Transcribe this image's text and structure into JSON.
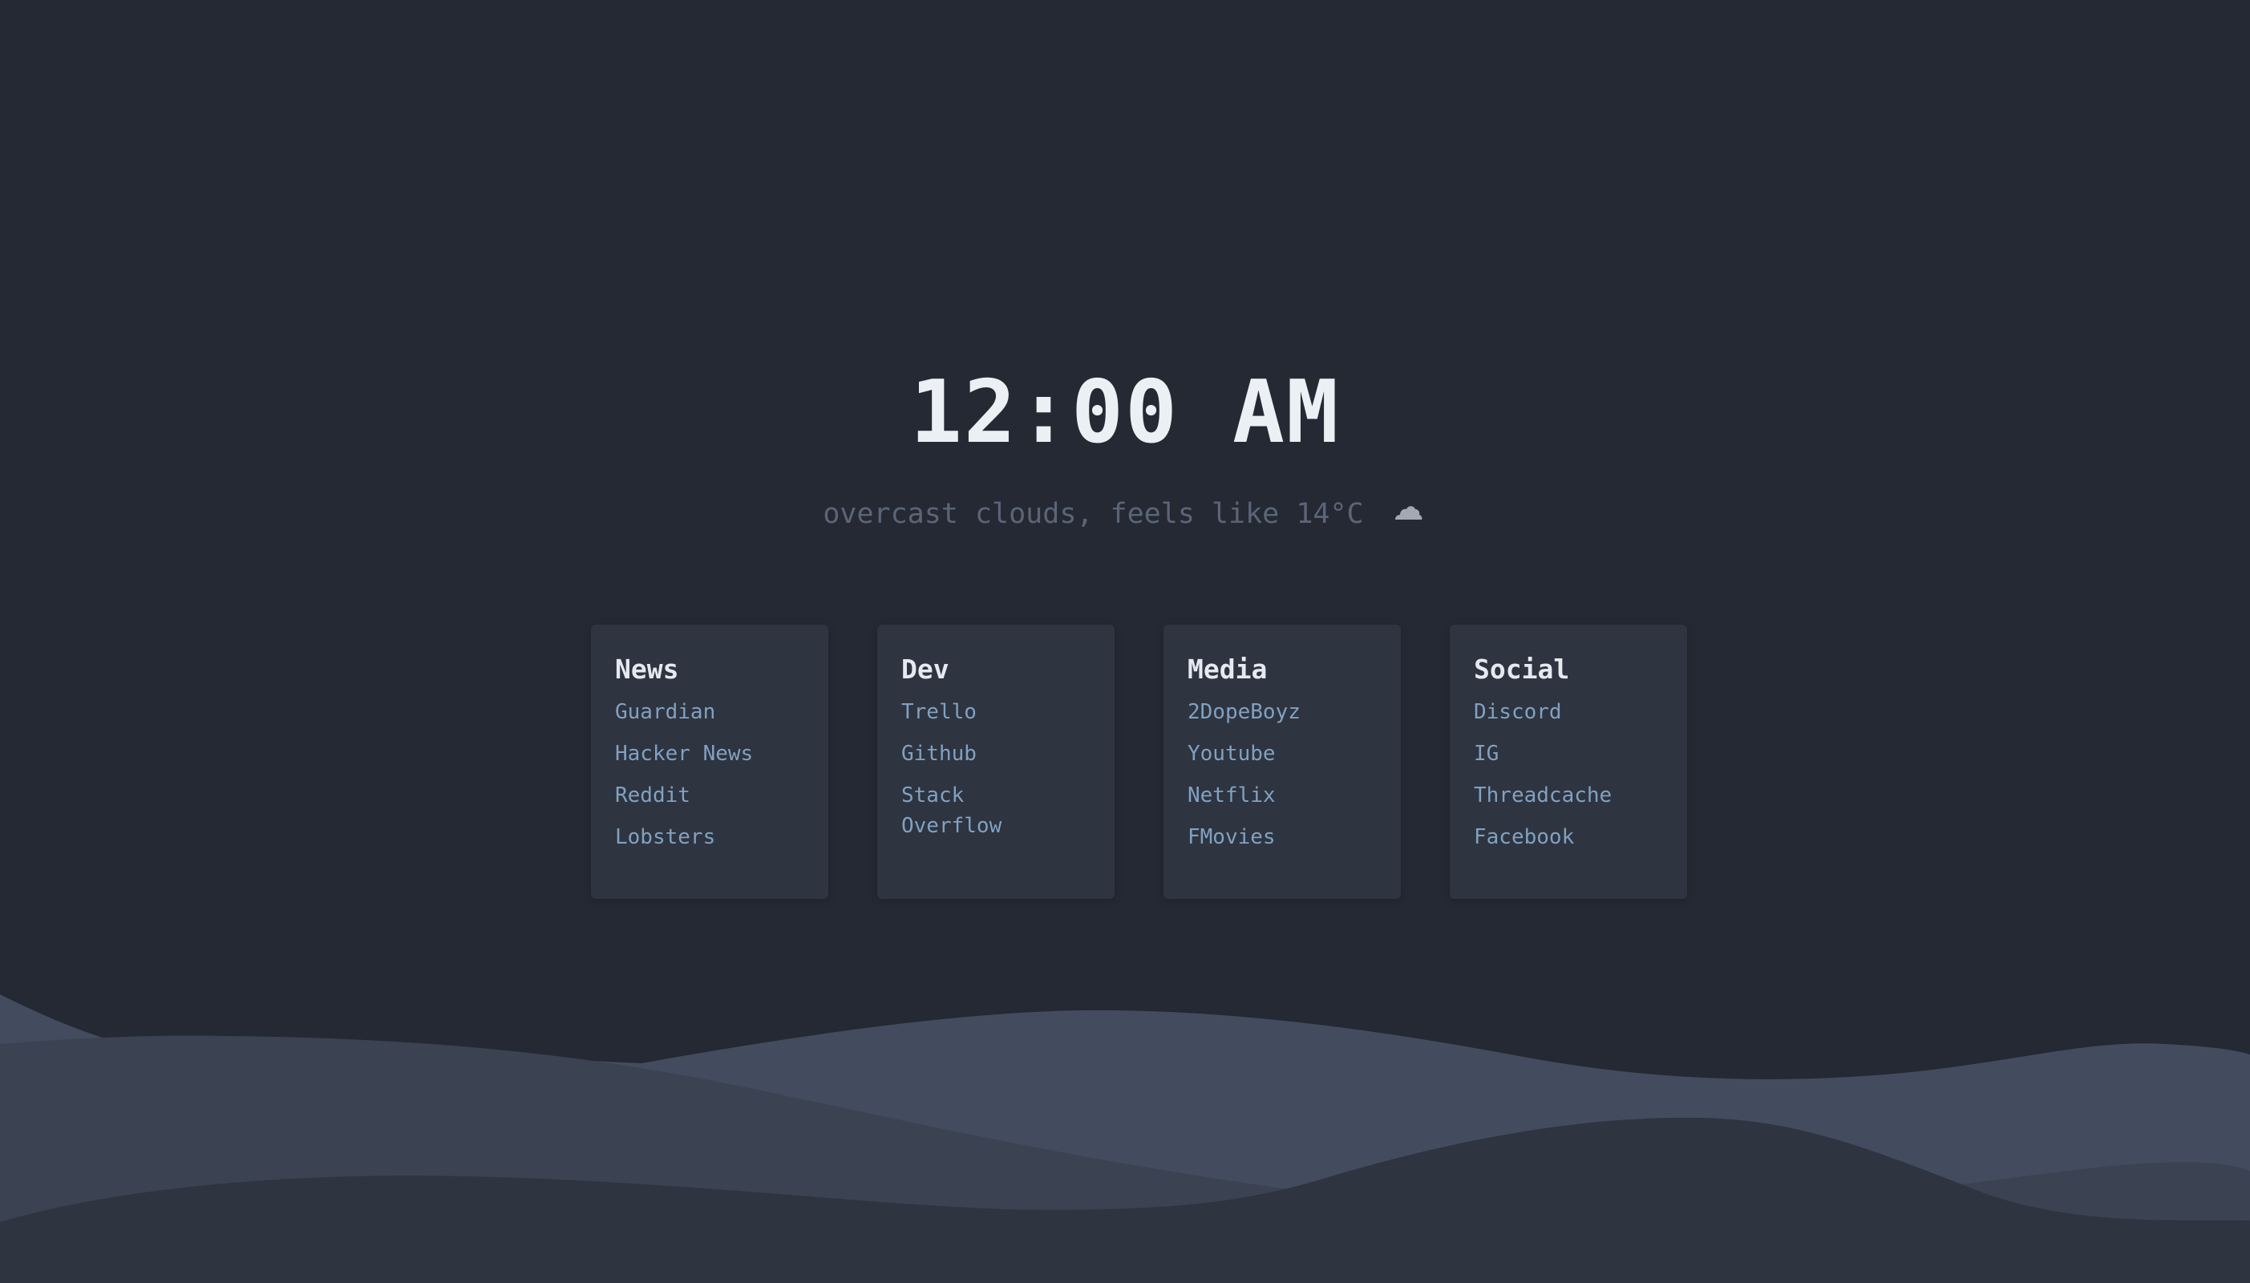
{
  "clock": {
    "time": "12:00 AM"
  },
  "weather": {
    "description": "overcast clouds, feels like 14°C",
    "icon": "cloud-moon-icon"
  },
  "colors": {
    "background": "#242933",
    "card": "#2e3440",
    "clock_text": "#eceff4",
    "weather_text": "#5b6577",
    "card_title": "#e5e9f0",
    "link": "#81a1c1",
    "wave_back": "#434c5e",
    "wave_mid": "#3b4252",
    "wave_front": "#2e3440"
  },
  "cards": [
    {
      "title": "News",
      "links": [
        {
          "label": "Guardian"
        },
        {
          "label": "Hacker News"
        },
        {
          "label": "Reddit"
        },
        {
          "label": "Lobsters"
        }
      ]
    },
    {
      "title": "Dev",
      "links": [
        {
          "label": "Trello"
        },
        {
          "label": "Github"
        },
        {
          "label": "Stack Overflow"
        }
      ]
    },
    {
      "title": "Media",
      "links": [
        {
          "label": "2DopeBoyz"
        },
        {
          "label": "Youtube"
        },
        {
          "label": "Netflix"
        },
        {
          "label": "FMovies"
        }
      ]
    },
    {
      "title": "Social",
      "links": [
        {
          "label": "Discord"
        },
        {
          "label": "IG"
        },
        {
          "label": "Threadcache"
        },
        {
          "label": "Facebook"
        }
      ]
    }
  ]
}
